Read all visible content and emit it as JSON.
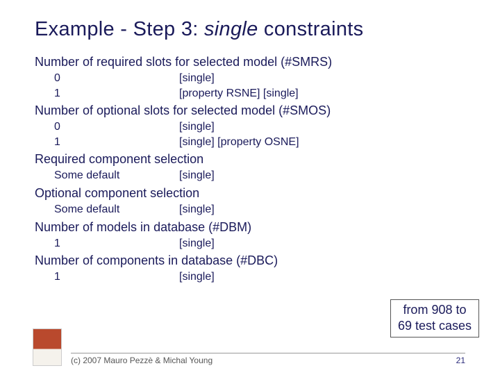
{
  "title": {
    "prefix": "Example - Step 3: ",
    "italic": "single ",
    "suffix": "constraints"
  },
  "sections": {
    "smrs": {
      "heading": "Number of required slots for selected model (#SMRS)",
      "rows": [
        {
          "left": "0",
          "right": "[single]"
        },
        {
          "left": "1",
          "right": "[property RSNE] [single]"
        }
      ]
    },
    "smos": {
      "heading": "Number of optional slots for selected model (#SMOS)",
      "rows": [
        {
          "left": "0",
          "right": "[single]"
        },
        {
          "left": "1",
          "right": "[single] [property OSNE]"
        }
      ]
    },
    "reqcomp": {
      "heading": "Required component selection",
      "rows": [
        {
          "left": "Some default",
          "right": "[single]"
        }
      ]
    },
    "optcomp": {
      "heading": "Optional component selection",
      "rows": [
        {
          "left": "Some default",
          "right": "[single]"
        }
      ]
    },
    "dbm": {
      "heading": "Number of models in database (#DBM)",
      "rows": [
        {
          "left": "1",
          "right": "[single]"
        }
      ]
    },
    "dbc": {
      "heading": "Number of components in database (#DBC)",
      "rows": [
        {
          "left": "1",
          "right": "[single]"
        }
      ]
    }
  },
  "callout": {
    "line1": "from 908 to",
    "line2": "69 test cases"
  },
  "footer": {
    "copyright": "(c) 2007 Mauro Pezzè & Michal Young",
    "page": "21"
  }
}
